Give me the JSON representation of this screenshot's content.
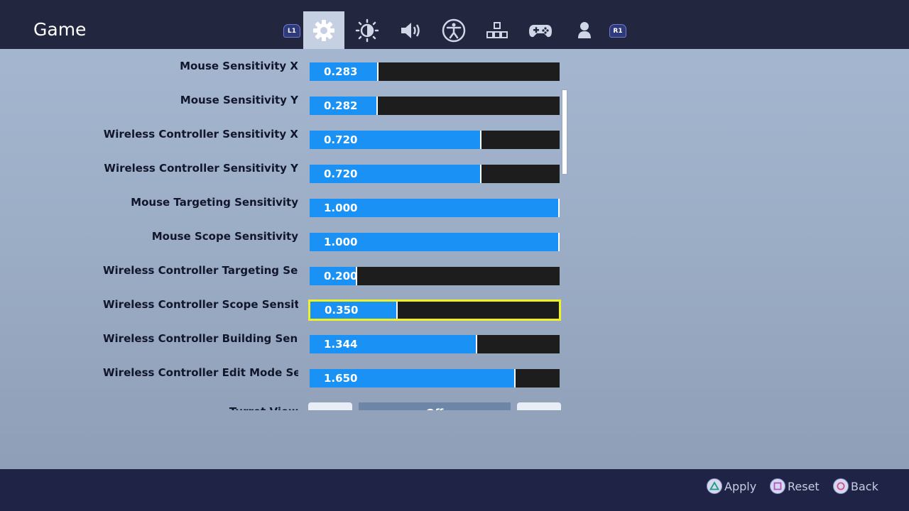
{
  "header": {
    "title": "Game",
    "left_bumper": "L1",
    "right_bumper": "R1",
    "tabs": [
      {
        "icon": "gear-icon",
        "active": true
      },
      {
        "icon": "brightness-icon",
        "active": false
      },
      {
        "icon": "speaker-icon",
        "active": false
      },
      {
        "icon": "accessibility-icon",
        "active": false
      },
      {
        "icon": "input-keys-icon",
        "active": false
      },
      {
        "icon": "gamepad-icon",
        "active": false
      },
      {
        "icon": "user-icon",
        "active": false
      }
    ]
  },
  "settings": [
    {
      "label": "Mouse Sensitivity X",
      "value": "0.283",
      "fill_fraction": 0.275,
      "focused": false
    },
    {
      "label": "Mouse Sensitivity Y",
      "value": "0.282",
      "fill_fraction": 0.272,
      "focused": false
    },
    {
      "label": "Wireless Controller Sensitivity X",
      "value": "0.720",
      "fill_fraction": 0.688,
      "focused": false
    },
    {
      "label": "Wireless Controller Sensitivity Y",
      "value": "0.720",
      "fill_fraction": 0.688,
      "focused": false
    },
    {
      "label": "Mouse Targeting Sensitivity",
      "value": "1.000",
      "fill_fraction": 1.0,
      "focused": false
    },
    {
      "label": "Mouse Scope Sensitivity",
      "value": "1.000",
      "fill_fraction": 1.0,
      "focused": false
    },
    {
      "label": "Wireless Controller Targeting Sen",
      "value": "0.200",
      "fill_fraction": 0.19,
      "focused": false
    },
    {
      "label": "Wireless Controller Scope Sensitivit",
      "value": "0.350",
      "fill_fraction": 0.35,
      "focused": true
    },
    {
      "label": "Wireless Controller Building Sensitivity",
      "value": "1.344",
      "fill_fraction": 0.67,
      "focused": false
    },
    {
      "label": "Wireless Controller Edit Mode Sensitivit",
      "value": "1.650",
      "fill_fraction": 0.825,
      "focused": false
    }
  ],
  "partial_row": {
    "label": "Turret View",
    "value": "Off"
  },
  "footer": {
    "apply_label": "Apply",
    "reset_label": "Reset",
    "back_label": "Back"
  },
  "colors": {
    "accent_fill": "#1a92f5",
    "focus_outline": "#f2f222",
    "header_bg": "#23263f",
    "footer_bg": "#1f2447"
  }
}
